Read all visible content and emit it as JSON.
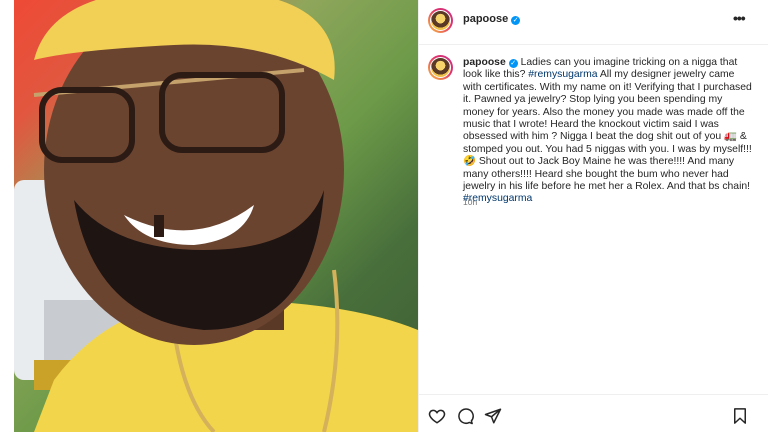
{
  "post": {
    "username": "papoose",
    "verified": true,
    "caption_parts": [
      {
        "type": "text",
        "value": " Ladies can you imagine tricking on a nigga that look like this? "
      },
      {
        "type": "tag",
        "value": "#remysugarma"
      },
      {
        "type": "text",
        "value": " All my designer jewelry came with certificates. With my name on it! Verifying that I purchased it. Pawned ya jewelry? Stop lying you been spending my money for years. Also the money you made was made off the music that I wrote! Heard the knockout victim said I was obsessed with him ? Nigga I beat the dog shit out of you 🚛 & stomped you out. You had 5 niggas with you. I was by myself!!! 🤣 Shout out to Jack Boy Maine he was there!!!! And many many others!!!! Heard she bought the bum who never had jewelry in his life before he met her a Rolex. And that bs chain! "
      },
      {
        "type": "tag",
        "value": "#remysugarma"
      }
    ],
    "timestamp": "10h"
  },
  "icons": {
    "more": "more-options-icon",
    "like": "heart-icon",
    "comment": "comment-icon",
    "share": "share-icon",
    "save": "bookmark-icon"
  },
  "colors": {
    "verified": "#0095f6",
    "hashtag": "#00376b",
    "timestamp": "#737373"
  }
}
